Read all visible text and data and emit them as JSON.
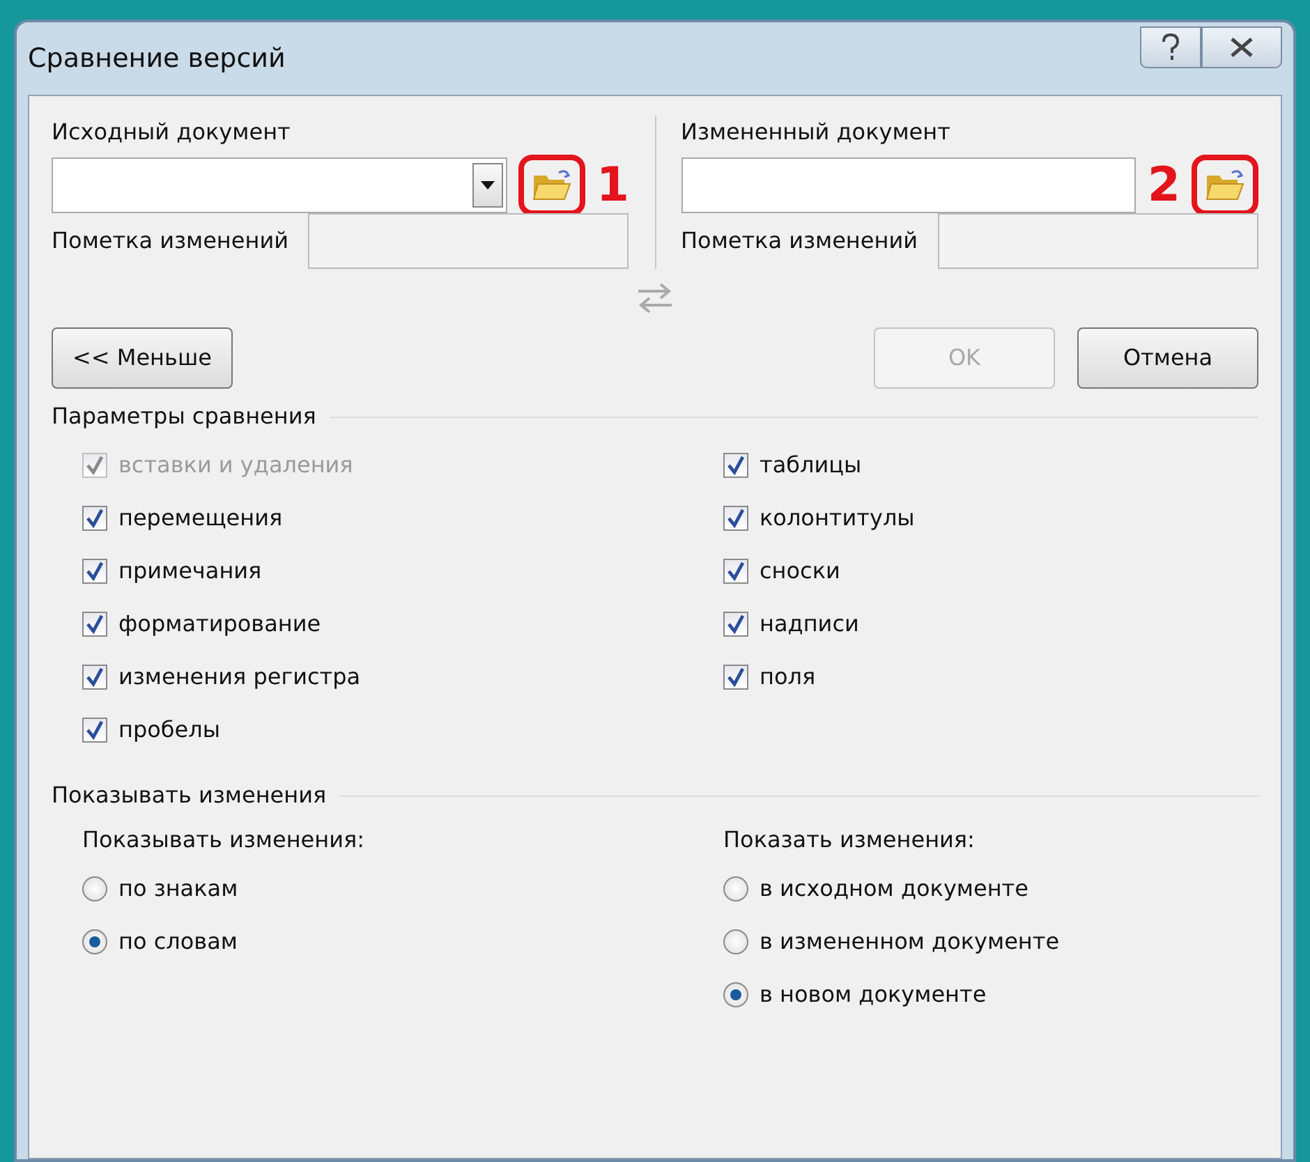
{
  "window": {
    "title": "Сравнение версий"
  },
  "documents": [
    {
      "label": "Исходный документ",
      "mark_label": "Пометка изменений",
      "annotation": "1"
    },
    {
      "label": "Измененный документ",
      "mark_label": "Пометка изменений",
      "annotation": "2"
    }
  ],
  "buttons": [
    {
      "label": "<< Меньше",
      "disabled": false
    },
    {
      "label": "OK",
      "disabled": true
    },
    {
      "label": "Отмена",
      "disabled": false
    }
  ],
  "comparison_settings": {
    "title": "Параметры сравнения",
    "columns": [
      [
        {
          "label": "вставки и удаления",
          "checked": true,
          "disabled": true
        },
        {
          "label": "перемещения",
          "checked": true,
          "disabled": false
        },
        {
          "label": "примечания",
          "checked": true,
          "disabled": false
        },
        {
          "label": "форматирование",
          "checked": true,
          "disabled": false
        },
        {
          "label": "изменения регистра",
          "checked": true,
          "disabled": false
        },
        {
          "label": "пробелы",
          "checked": true,
          "disabled": false
        }
      ],
      [
        {
          "label": "таблицы",
          "checked": true,
          "disabled": false
        },
        {
          "label": "колонтитулы",
          "checked": true,
          "disabled": false
        },
        {
          "label": "сноски",
          "checked": true,
          "disabled": false
        },
        {
          "label": "надписи",
          "checked": true,
          "disabled": false
        },
        {
          "label": "поля",
          "checked": true,
          "disabled": false
        }
      ]
    ]
  },
  "show_changes": {
    "title": "Показывать изменения",
    "groups": [
      {
        "label": "Показывать изменения:",
        "options": [
          {
            "label": "по знакам",
            "selected": false
          },
          {
            "label": "по словам",
            "selected": true
          }
        ]
      },
      {
        "label": "Показать изменения:",
        "options": [
          {
            "label": "в исходном документе",
            "selected": false
          },
          {
            "label": "в измененном документе",
            "selected": false
          },
          {
            "label": "в новом документе",
            "selected": true
          }
        ]
      }
    ]
  }
}
